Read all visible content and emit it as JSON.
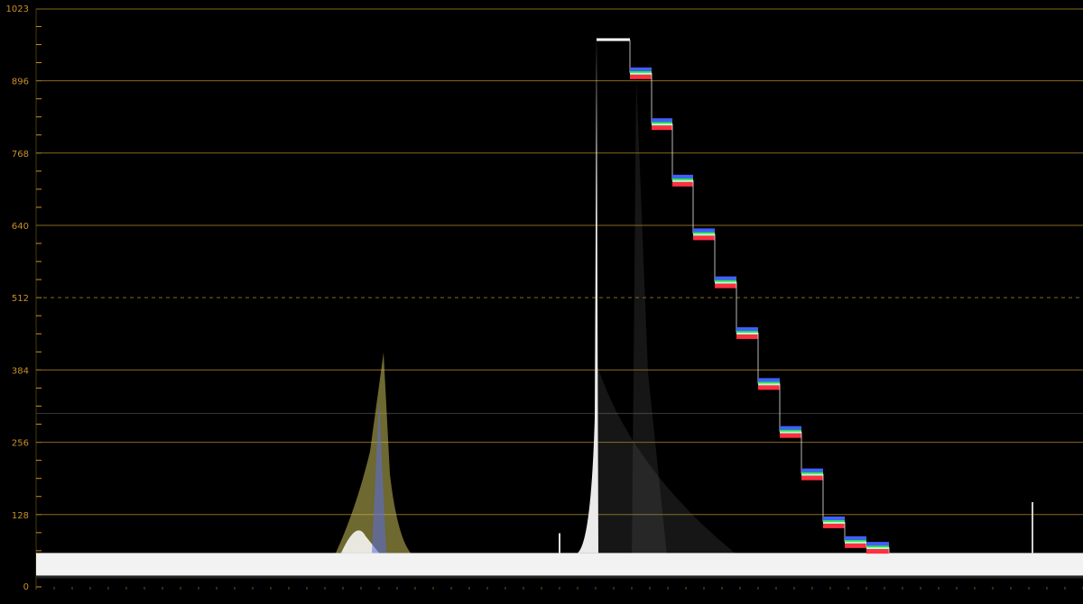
{
  "scope": {
    "type": "waveform",
    "scale_max": 1023,
    "scale_min": 0,
    "y_labels": [
      "1023",
      "896",
      "768",
      "640",
      "512",
      "384",
      "256",
      "128",
      "0"
    ],
    "y_label_values": [
      1023,
      896,
      768,
      640,
      512,
      384,
      256,
      128,
      0
    ],
    "solid_gridlines": [
      1023,
      896,
      768,
      640,
      384,
      256,
      128
    ],
    "dashed_gridlines": [
      512
    ],
    "extra_gray_lines": [
      307
    ],
    "grid_color": "#8a6a1e",
    "label_color": "#c8902a",
    "background": "#000000"
  },
  "chart_data": {
    "type": "waveform",
    "ylim": [
      0,
      1023
    ],
    "y_ticks": [
      0,
      128,
      256,
      384,
      512,
      640,
      768,
      896,
      1023
    ],
    "baseline_level": 40,
    "step_levels": [
      968,
      910,
      820,
      720,
      625,
      540,
      450,
      360,
      275,
      200,
      115,
      80,
      70
    ],
    "peaks": [
      {
        "x_fraction": 0.35,
        "level": 415
      },
      {
        "x_fraction": 0.955,
        "level": 150
      }
    ]
  }
}
